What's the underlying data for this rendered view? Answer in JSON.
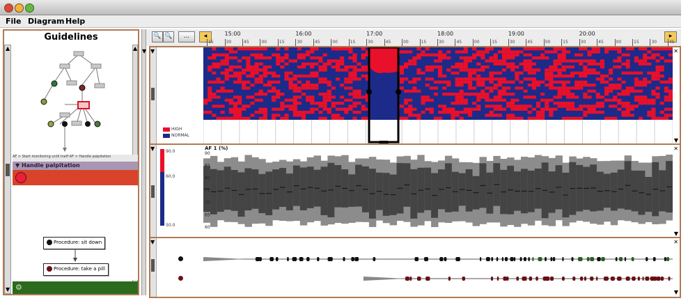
{
  "window": {
    "controls": [
      "close",
      "minimize",
      "zoom"
    ],
    "colors": {
      "close": "#e0443a",
      "minimize": "#f3b33a",
      "zoom": "#66b843"
    }
  },
  "menubar": {
    "items": [
      "File",
      "Diagram",
      "Help"
    ]
  },
  "left_panel": {
    "title": "Guidelines",
    "breadcrumb": "AF > Start monitoring until Ineff AF > Handle palpitation",
    "step_header": "Handle palpitation",
    "procedures": [
      {
        "label": "Procedure: sit down",
        "dot_color": "#111111"
      },
      {
        "label": "Procedure: take a pill",
        "dot_color": "#6a0f14"
      }
    ]
  },
  "toolbar": {
    "zoom_in_icon": "zoom-in-icon",
    "zoom_out_icon": "zoom-out-icon",
    "ellipsis_label": "...",
    "hours": [
      "15:00",
      "16:00",
      "17:00",
      "18:00",
      "19:00",
      "20:00"
    ],
    "subticks": [
      "00",
      "15",
      "30",
      "45"
    ]
  },
  "heatmap": {
    "legend": [
      {
        "label": "HIGH",
        "color": "#e8102a"
      },
      {
        "label": "NORMAL",
        "color": "#1c2a8a"
      }
    ]
  },
  "band_chart": {
    "title": "AF 1 (%)",
    "yaxis_ticks": [
      "90",
      "85",
      "80",
      "75",
      "70",
      "65",
      "60"
    ],
    "scale_labels": [
      "90.0",
      "60.0",
      "50.0"
    ]
  },
  "events": {
    "row_colors": [
      "#111111",
      "#6a0f14"
    ]
  },
  "colors": {
    "panel_border": "#b07a52",
    "heat_high": "#e8102a",
    "heat_normal": "#1c2a8a",
    "band_outer": "#8c8c8c",
    "band_inner": "#444444",
    "step_header": "#a996b2",
    "active_step": "#d9432c",
    "footer_green": "#2c6a1e"
  }
}
